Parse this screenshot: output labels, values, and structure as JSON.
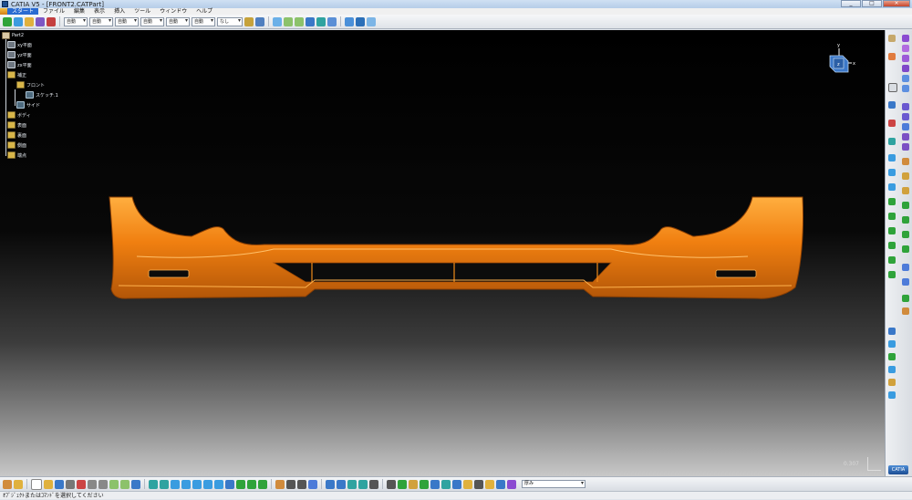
{
  "window": {
    "title": "CATIA V5 - [FRONT2.CATPart]",
    "minimize": "_",
    "maximize": "□",
    "close": "×"
  },
  "menu": {
    "items": [
      "スタート",
      "ファイル",
      "編集",
      "表示",
      "挿入",
      "ツール",
      "ウィンドウ",
      "ヘルプ"
    ]
  },
  "top_toolbar": {
    "dropdowns": [
      "自動",
      "自動",
      "自動",
      "自動",
      "自動",
      "自動",
      "なし"
    ]
  },
  "tree": {
    "root": "Part2",
    "planes": [
      "xy平面",
      "yz平面",
      "zx平面"
    ],
    "set": "補正",
    "subset": "フロント",
    "sketch": "スケッチ.1",
    "side": "サイド",
    "body": "ボディ",
    "others": [
      "表面",
      "裏面",
      "側面",
      "端点"
    ]
  },
  "compass": {
    "x": "x",
    "y": "y",
    "z": "z"
  },
  "viewport": {
    "scale": "0.307",
    "part_color": "#f07f10"
  },
  "bottom_toolbar": {
    "material": "厚み"
  },
  "status": {
    "message": "ｵﾌﾞｼﾞｪｸﾄまたはｺﾏﾝﾄﾞを選択してください"
  },
  "branding": {
    "logo": "CATIA"
  }
}
